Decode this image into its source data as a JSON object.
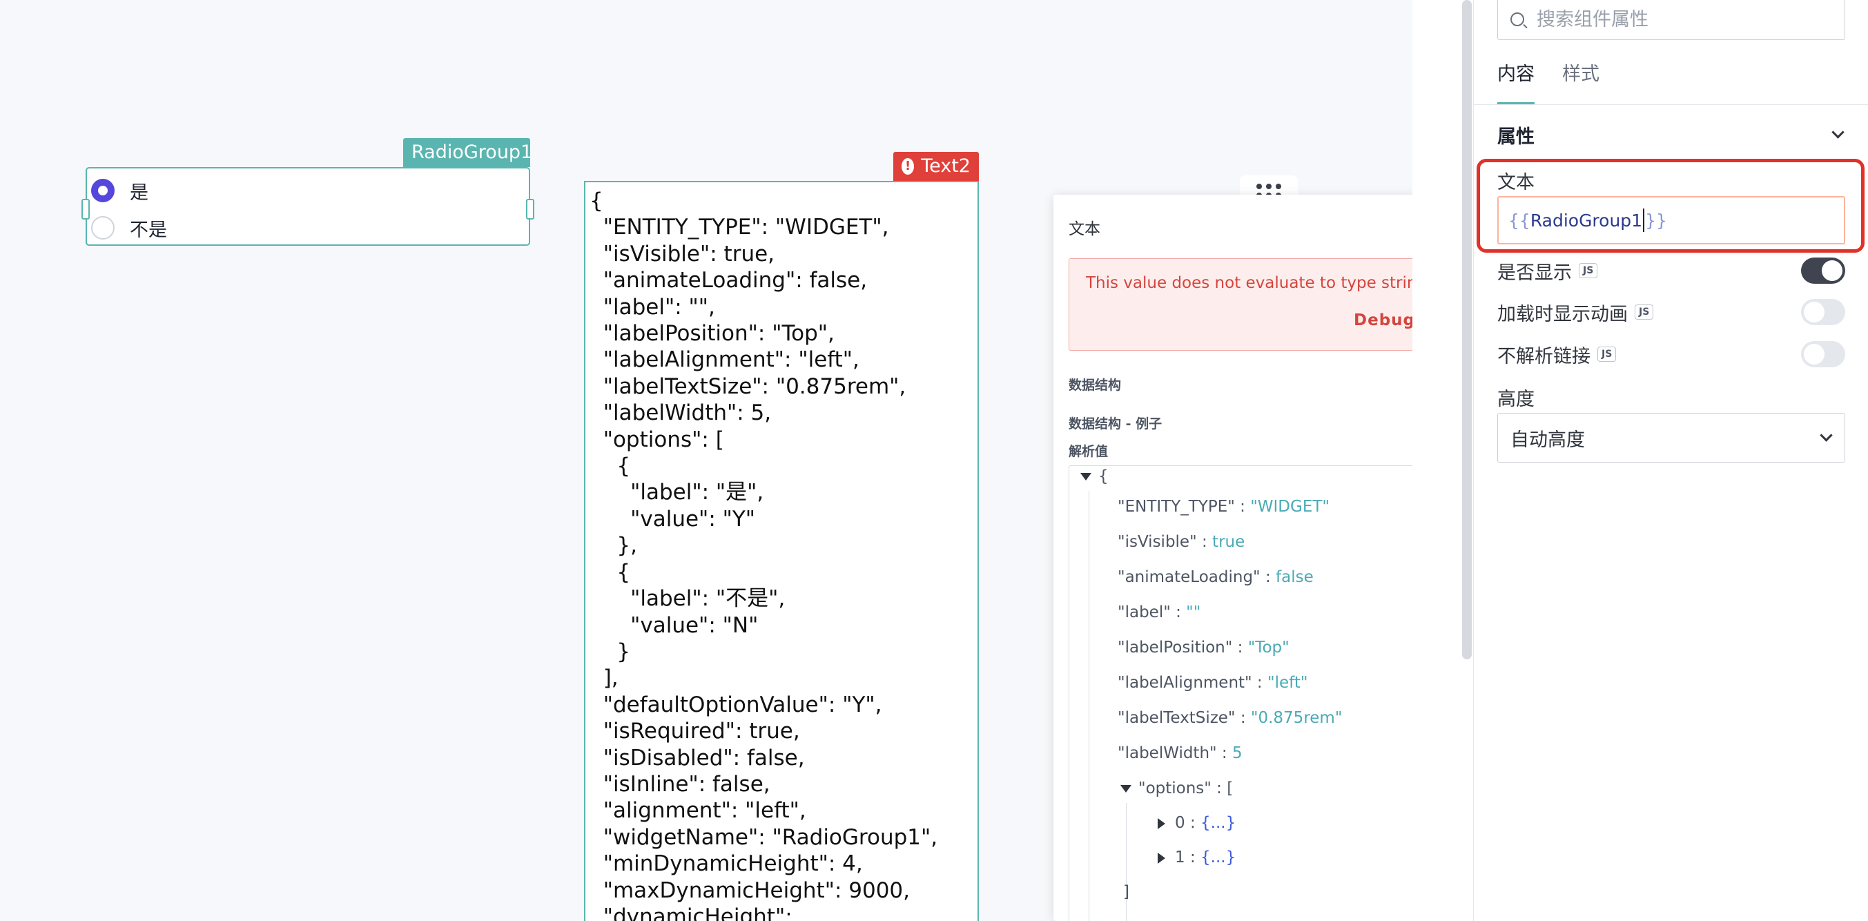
{
  "canvas": {
    "radio_group": {
      "name": "RadioGroup1",
      "options": [
        {
          "label": "是",
          "checked": true
        },
        {
          "label": "不是",
          "checked": false
        }
      ]
    },
    "text_widget": {
      "name": "Text2",
      "status": "error",
      "content": "{\n  \"ENTITY_TYPE\": \"WIDGET\",\n  \"isVisible\": true,\n  \"animateLoading\": false,\n  \"label\": \"\",\n  \"labelPosition\": \"Top\",\n  \"labelAlignment\": \"left\",\n  \"labelTextSize\": \"0.875rem\",\n  \"labelWidth\": 5,\n  \"options\": [\n    {\n      \"label\": \"是\",\n      \"value\": \"Y\"\n    },\n    {\n      \"label\": \"不是\",\n      \"value\": \"N\"\n    }\n  ],\n  \"defaultOptionValue\": \"Y\",\n  \"isRequired\": true,\n  \"isDisabled\": false,\n  \"isInline\": false,\n  \"alignment\": \"left\",\n  \"widgetName\": \"RadioGroup1\",\n  \"minDynamicHeight\": 4,\n  \"maxDynamicHeight\": 9000,\n  \"dynamicHeight\":"
    }
  },
  "popup": {
    "title": "文本",
    "error_message": "This value does not evaluate to type string",
    "debug_label": "Debug",
    "sections": {
      "schema": "数据结构",
      "schema_example": "数据结构 - 例子",
      "evaluated": "解析值"
    },
    "tree": {
      "open_brace": "{",
      "close_bracket": "]",
      "entries": [
        {
          "key": "\"ENTITY_TYPE\"",
          "sep": " : ",
          "value": "\"WIDGET\""
        },
        {
          "key": "\"isVisible\"",
          "sep": " : ",
          "value": "true"
        },
        {
          "key": "\"animateLoading\"",
          "sep": " : ",
          "value": "false"
        },
        {
          "key": "\"label\"",
          "sep": " : ",
          "value": "\"\""
        },
        {
          "key": "\"labelPosition\"",
          "sep": " : ",
          "value": "\"Top\""
        },
        {
          "key": "\"labelAlignment\"",
          "sep": " : ",
          "value": "\"left\""
        },
        {
          "key": "\"labelTextSize\"",
          "sep": " : ",
          "value": "\"0.875rem\""
        },
        {
          "key": "\"labelWidth\"",
          "sep": " : ",
          "value": "5"
        }
      ],
      "options_key": "\"options\"",
      "options_open": " : [",
      "options_items": [
        {
          "index": "0",
          "sep": " : ",
          "collapsed": "{...}"
        },
        {
          "index": "1",
          "sep": " : ",
          "collapsed": "{...}"
        }
      ]
    }
  },
  "panel": {
    "search_placeholder": "搜索组件属性",
    "tabs": [
      {
        "label": "内容",
        "active": true
      },
      {
        "label": "样式",
        "active": false
      }
    ],
    "section_title": "属性",
    "text_property": {
      "label": "文本",
      "open": "{{",
      "binding": "RadioGroup1",
      "close": "}}"
    },
    "toggles": [
      {
        "label": "是否显示",
        "badge": "JS",
        "on": true
      },
      {
        "label": "加载时显示动画",
        "badge": "JS",
        "on": false
      },
      {
        "label": "不解析链接",
        "badge": "JS",
        "on": false
      }
    ],
    "height": {
      "label": "高度",
      "value": "自动高度"
    }
  },
  "colors": {
    "accent": "#5ab5b0",
    "radio_checked": "#5547db",
    "error": "#e0403a",
    "json_value": "#4aaab5"
  },
  "icons": [
    "search-icon",
    "warning-icon",
    "drag-handle-icon",
    "chevron-down-icon",
    "chevron-right-icon",
    "caret-down-icon",
    "caret-right-icon"
  ]
}
